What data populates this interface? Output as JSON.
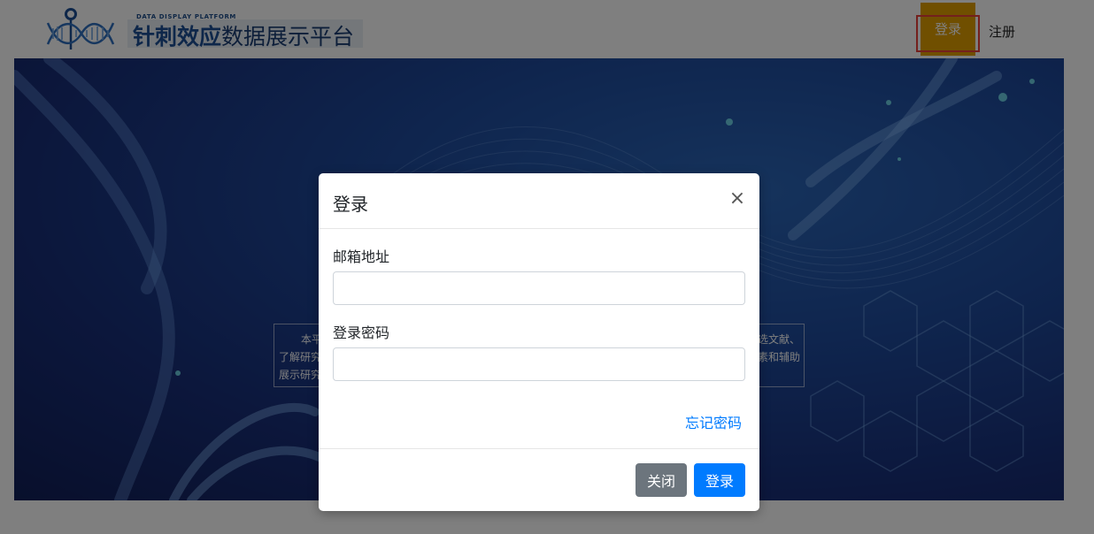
{
  "header": {
    "logo_subtitle": "DATA DISPLAY PLATFORM",
    "logo_title_bold": "针刺效应",
    "logo_title_rest": "数据展示平台",
    "nav": {
      "login_label": "登录",
      "register_label": "注册"
    }
  },
  "hero": {
    "intro_left": [
      "本平",
      "了解研究",
      "展示研究"
    ],
    "intro_right": [
      "选文献、",
      "素和辅助"
    ]
  },
  "modal": {
    "title": "登录",
    "close_icon": "close-icon",
    "email_label": "邮箱地址",
    "email_value": "",
    "password_label": "登录密码",
    "password_value": "",
    "forgot_password": "忘记密码",
    "close_button": "关闭",
    "login_button": "登录"
  },
  "colors": {
    "nav_active_bg": "#e19e00",
    "highlight_outline": "#e8413a",
    "primary": "#007bff",
    "secondary": "#6c757d",
    "logo_blue": "#1c4f94",
    "hero_blue": "#1e4a9c"
  }
}
